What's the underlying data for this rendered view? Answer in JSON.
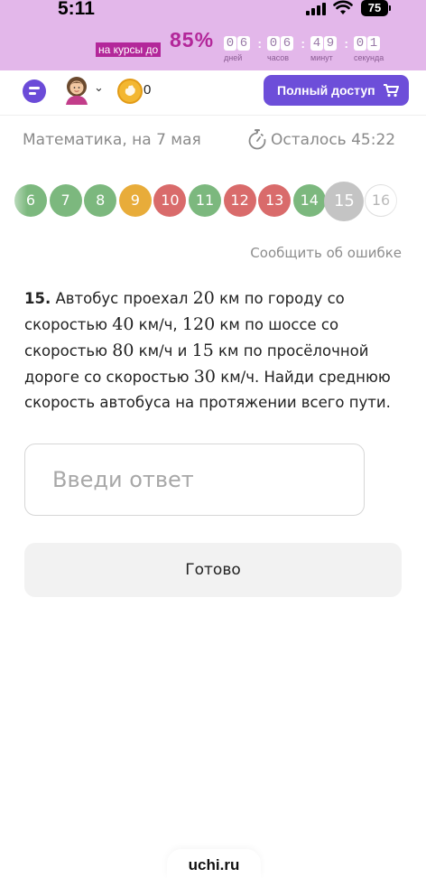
{
  "status_bar": {
    "time": "5:11",
    "battery": "75"
  },
  "promo": {
    "label": "на курсы до",
    "percent": "85%",
    "timer": [
      {
        "digits": [
          "0",
          "6"
        ],
        "label": "дней"
      },
      {
        "digits": [
          "0",
          "6"
        ],
        "label": "часов"
      },
      {
        "digits": [
          "4",
          "9"
        ],
        "label": "минут"
      },
      {
        "digits": [
          "0",
          "1"
        ],
        "label": "секунда"
      }
    ]
  },
  "header": {
    "coins": "0",
    "full_access_label": "Полный доступ"
  },
  "lesson": {
    "subject": "Математика, на 7 мая",
    "remaining": "Осталось 45:22"
  },
  "questions": [
    {
      "num": "6",
      "status": "correct"
    },
    {
      "num": "7",
      "status": "correct"
    },
    {
      "num": "8",
      "status": "correct"
    },
    {
      "num": "9",
      "status": "partial"
    },
    {
      "num": "10",
      "status": "wrong"
    },
    {
      "num": "11",
      "status": "correct"
    },
    {
      "num": "12",
      "status": "wrong"
    },
    {
      "num": "13",
      "status": "wrong"
    },
    {
      "num": "14",
      "status": "correct"
    },
    {
      "num": "15",
      "status": "current"
    },
    {
      "num": "16",
      "status": "upcoming"
    }
  ],
  "colors": {
    "correct": "#7cb87e",
    "partial": "#e8ac3a",
    "wrong": "#d96b6b",
    "current": "#c4c4c4",
    "accent": "#6d4ed9"
  },
  "report_label": "Сообщить об ошибке",
  "task": {
    "number": "15.",
    "parts": [
      {
        "t": "text",
        "v": " Автобус проехал "
      },
      {
        "t": "math",
        "v": "20"
      },
      {
        "t": "text",
        "v": " км по городу со скоростью "
      },
      {
        "t": "math",
        "v": "40"
      },
      {
        "t": "text",
        "v": " км/ч, "
      },
      {
        "t": "math",
        "v": "120"
      },
      {
        "t": "text",
        "v": " км по шоссе со скоростью "
      },
      {
        "t": "math",
        "v": "80"
      },
      {
        "t": "text",
        "v": " км/ч и "
      },
      {
        "t": "math",
        "v": "15"
      },
      {
        "t": "text",
        "v": " км по просёлочной дороге со скоростью "
      },
      {
        "t": "math",
        "v": "30"
      },
      {
        "t": "text",
        "v": " км/ч. Найди среднюю скорость автобуса на протяжении всего пути."
      }
    ]
  },
  "answer": {
    "placeholder": "Введи ответ",
    "value": ""
  },
  "done_label": "Готово",
  "footer_brand": "uchi.ru"
}
